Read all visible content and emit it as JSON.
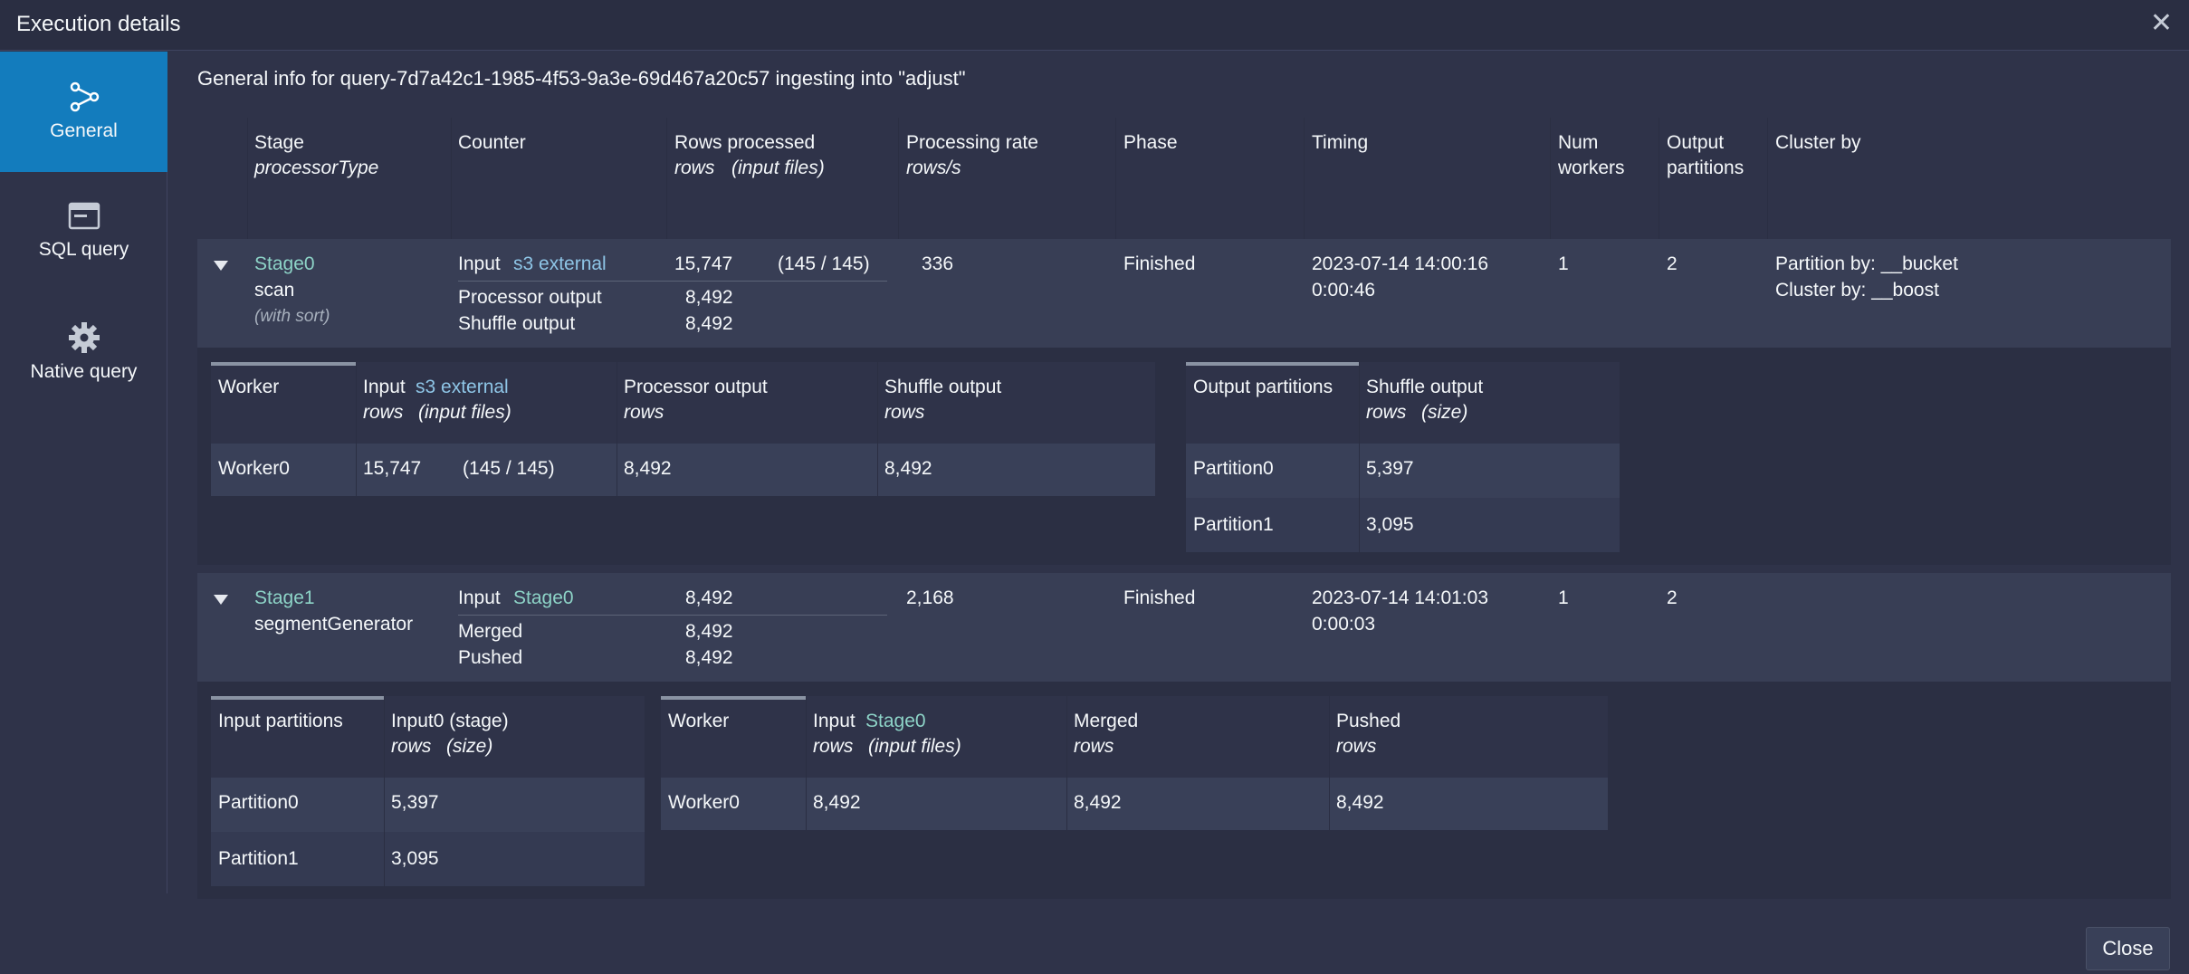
{
  "window": {
    "title": "Execution details"
  },
  "sidebar": {
    "items": [
      {
        "label": "General",
        "icon": "graph-icon",
        "active": true
      },
      {
        "label": "SQL query",
        "icon": "application-icon",
        "active": false
      },
      {
        "label": "Native query",
        "icon": "cog-icon",
        "active": false
      }
    ]
  },
  "general_info": "General info for query-7d7a42c1-1985-4f53-9a3e-69d467a20c57 ingesting into \"adjust\"",
  "header": {
    "stage": "Stage",
    "stage_sub": "processorType",
    "counter": "Counter",
    "rows": "Rows processed",
    "rows_sub1": "rows",
    "rows_sub2": "(input files)",
    "rate": "Processing rate",
    "rate_sub": "rows/s",
    "phase": "Phase",
    "timing": "Timing",
    "workers1": "Num",
    "workers2": "workers",
    "outparts1": "Output",
    "outparts2": "partitions",
    "cluster": "Cluster by"
  },
  "stages": [
    {
      "name": "Stage0",
      "type": "scan",
      "note": "(with sort)",
      "input_label": "Input",
      "input_src": "s3 external",
      "input_rows": "15,747",
      "input_files": "(145 / 145)",
      "counter2_label": "Processor output",
      "counter2_val": "8,492",
      "counter3_label": "Shuffle output",
      "counter3_val": "8,492",
      "rate": "336",
      "phase": "Finished",
      "timing_start": "2023-07-14 14:00:16",
      "timing_dur": "0:00:46",
      "workers": "1",
      "out_partitions": "2",
      "cluster_1": "Partition by: __bucket",
      "cluster_2": "Cluster by: __boost"
    },
    {
      "name": "Stage1",
      "type": "segmentGenerator",
      "input_label": "Input",
      "input_src": "Stage0",
      "input_rows": "8,492",
      "counter2_label": "Merged",
      "counter2_val": "8,492",
      "counter3_label": "Pushed",
      "counter3_val": "8,492",
      "rate": "2,168",
      "phase": "Finished",
      "timing_start": "2023-07-14 14:01:03",
      "timing_dur": "0:00:03",
      "workers": "1",
      "out_partitions": "2"
    }
  ],
  "stage0_workers": {
    "h_worker": "Worker",
    "h_input": "Input",
    "h_input_src": "s3 external",
    "h_input_sub1": "rows",
    "h_input_sub2": "(input files)",
    "h_proc": "Processor output",
    "h_proc_sub": "rows",
    "h_shuffle": "Shuffle output",
    "h_shuffle_sub": "rows",
    "row": {
      "worker": "Worker0",
      "rows": "15,747",
      "files": "(145 / 145)",
      "proc": "8,492",
      "shuffle": "8,492"
    }
  },
  "stage0_partitions": {
    "h_part": "Output partitions",
    "h_shuffle": "Shuffle output",
    "h_shuffle_sub1": "rows",
    "h_shuffle_sub2": "(size)",
    "rows": [
      {
        "part": "Partition0",
        "val": "5,397"
      },
      {
        "part": "Partition1",
        "val": "3,095"
      }
    ]
  },
  "stage1_inputs": {
    "h_part": "Input partitions",
    "h_input": "Input0 (stage)",
    "h_input_sub1": "rows",
    "h_input_sub2": "(size)",
    "rows": [
      {
        "part": "Partition0",
        "val": "5,397"
      },
      {
        "part": "Partition1",
        "val": "3,095"
      }
    ]
  },
  "stage1_workers": {
    "h_worker": "Worker",
    "h_input": "Input",
    "h_input_src": "Stage0",
    "h_input_sub1": "rows",
    "h_input_sub2": "(input files)",
    "h_merged": "Merged",
    "h_merged_sub": "rows",
    "h_pushed": "Pushed",
    "h_pushed_sub": "rows",
    "row": {
      "worker": "Worker0",
      "input": "8,492",
      "merged": "8,492",
      "pushed": "8,492"
    }
  },
  "close_label": "Close"
}
